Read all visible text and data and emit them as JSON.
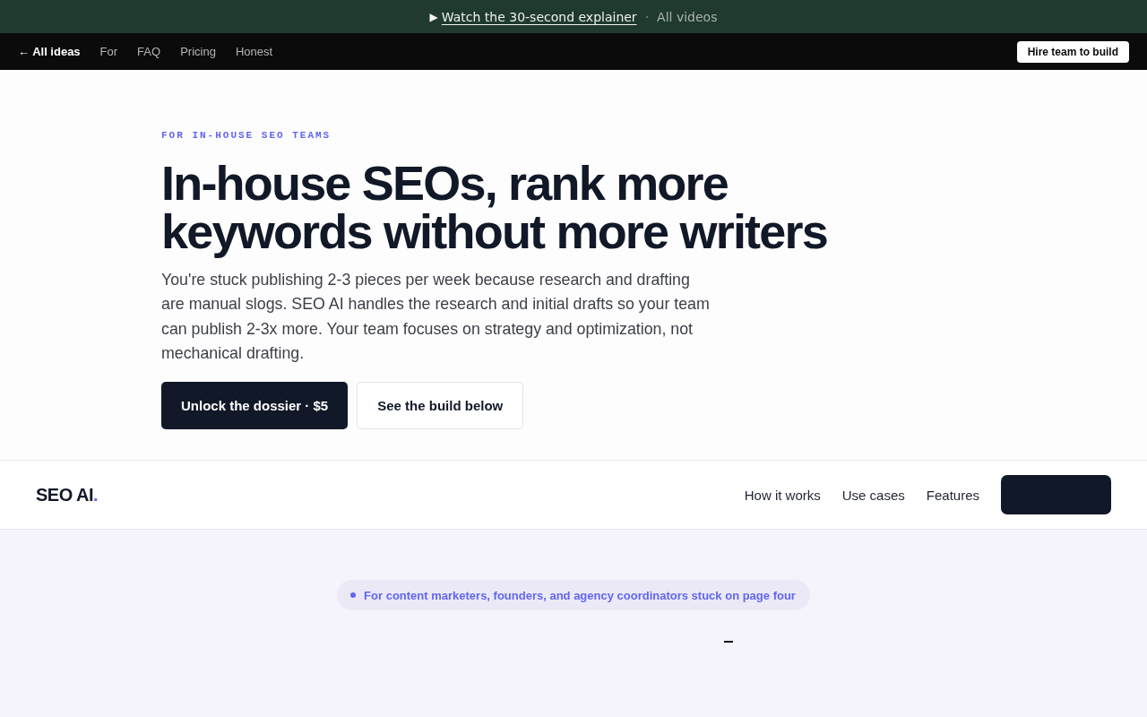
{
  "banner": {
    "play_icon": "▶",
    "link": "Watch the 30-second explainer",
    "separator": "·",
    "secondary_link": "All videos"
  },
  "top_nav": {
    "back_link": "← All ideas",
    "links": [
      "For",
      "FAQ",
      "Pricing",
      "Honest"
    ],
    "cta": "Hire team to build"
  },
  "hero": {
    "eyebrow": "FOR IN-HOUSE SEO TEAMS",
    "heading": "In-house SEOs, rank more keywords without more writers",
    "description": "You're stuck publishing 2-3 pieces per week because research and drafting are manual slogs. SEO AI handles the research and initial drafts so your team can publish 2-3x more. Your team focuses on strategy and optimization, not mechanical drafting.",
    "buttons": [
      {
        "label": "Unlock the dossier · $5",
        "kind": "primary"
      },
      {
        "label": "See the build below",
        "kind": "secondary"
      }
    ]
  },
  "product_nav": {
    "logo": {
      "text": "SEO AI",
      "dot": "."
    },
    "links": [
      "How it works",
      "Use cases",
      "Features"
    ]
  },
  "feature_section": {
    "pill": "For content marketers, founders, and agency coordinators stuck on page four"
  }
}
